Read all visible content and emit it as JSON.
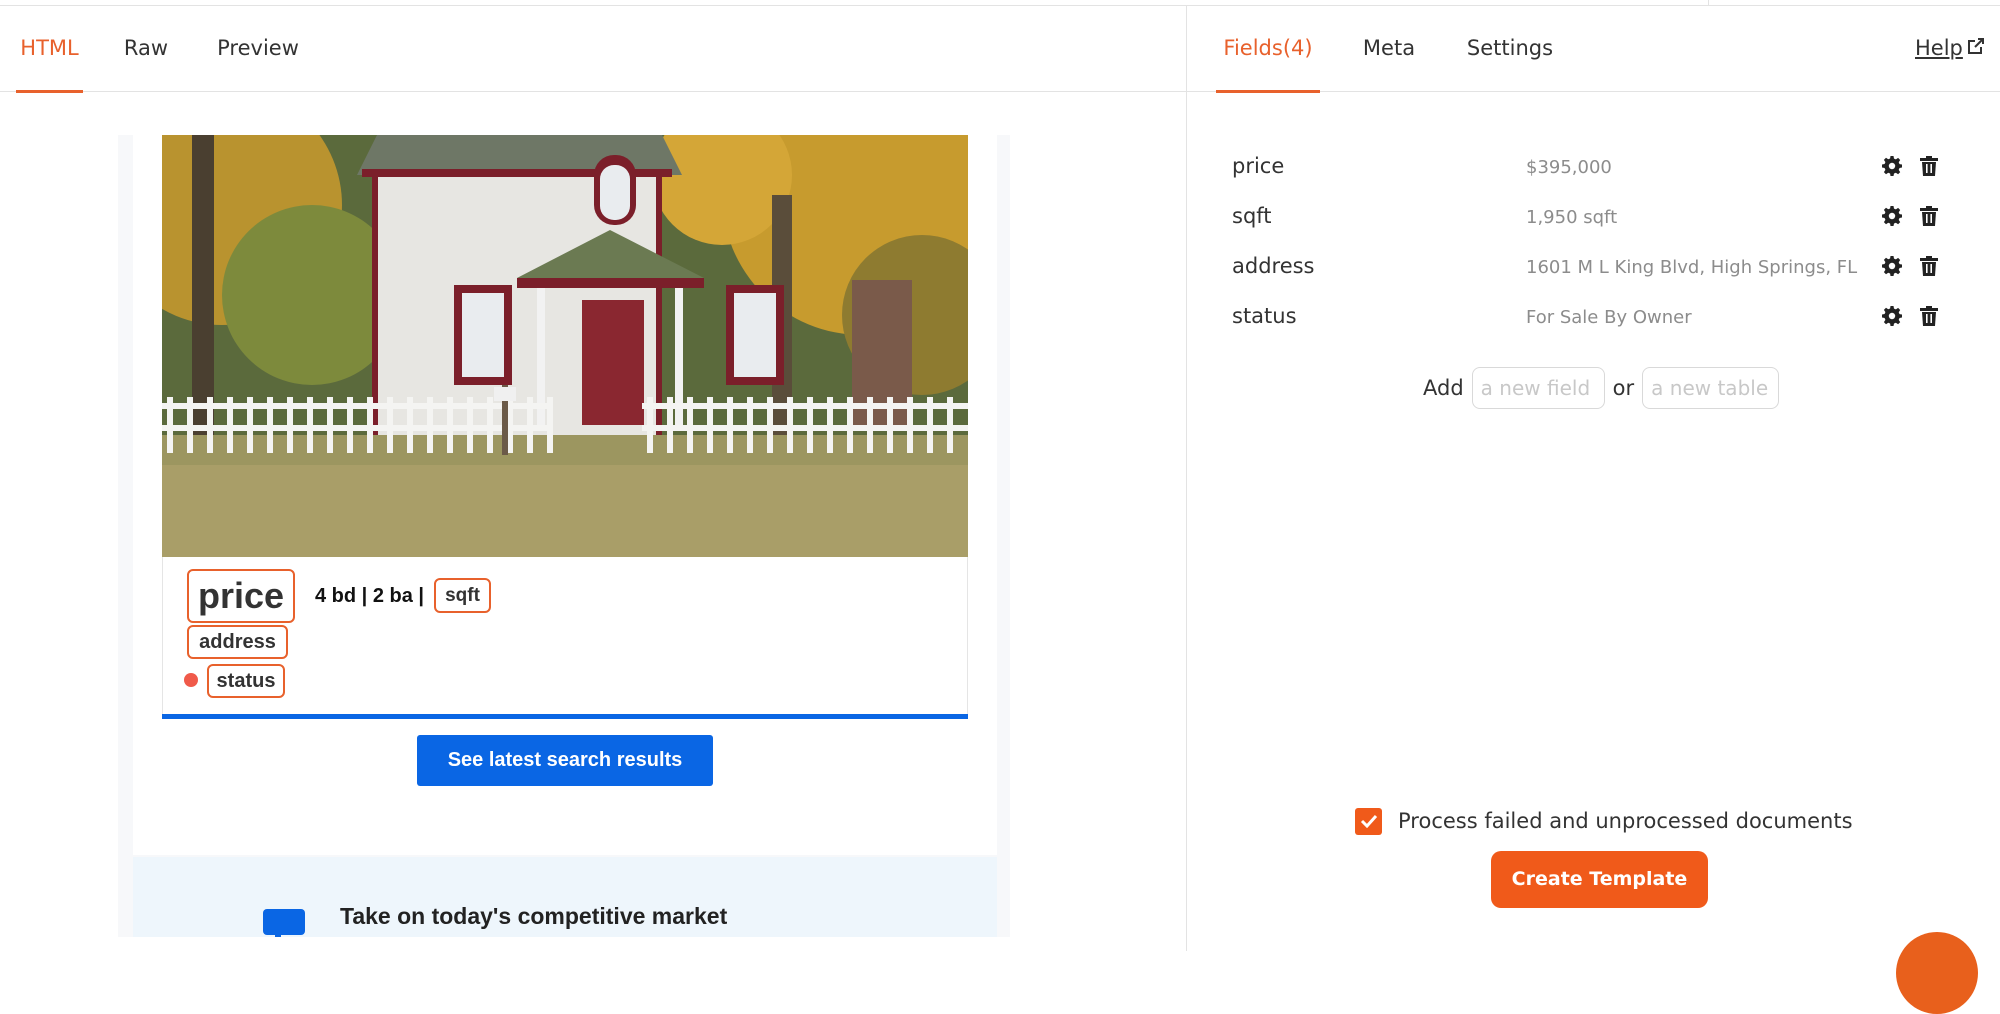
{
  "left_tabs": [
    {
      "label": "HTML",
      "active": true
    },
    {
      "label": "Raw",
      "active": false
    },
    {
      "label": "Preview",
      "active": false
    }
  ],
  "preview": {
    "chips": {
      "price": "price",
      "sqft": "sqft",
      "address": "address",
      "status": "status"
    },
    "beds_baths": "4 bd | 2 ba |",
    "search_button": "See latest search results",
    "promo_title": "Take on today's competitive market",
    "colors": {
      "chip_border": "#e8612c",
      "accent_blue": "#0a66e4",
      "status_dot": "#f05a4a"
    }
  },
  "right_tabs": [
    {
      "label": "Fields(4)",
      "active": true
    },
    {
      "label": "Meta",
      "active": false
    },
    {
      "label": "Settings",
      "active": false
    }
  ],
  "help_label": "Help",
  "fields": [
    {
      "name": "price",
      "value": "$395,000"
    },
    {
      "name": "sqft",
      "value": "1,950 sqft"
    },
    {
      "name": "address",
      "value": "1601 M L King Blvd, High Springs, FL"
    },
    {
      "name": "status",
      "value": "For Sale By Owner"
    }
  ],
  "add": {
    "label": "Add",
    "field_placeholder": "a new field",
    "or_label": "or",
    "table_placeholder": "a new table"
  },
  "process": {
    "label": "Process failed and unprocessed documents",
    "checked": true
  },
  "create_button": "Create Template",
  "accent_color": "#f05a1a"
}
